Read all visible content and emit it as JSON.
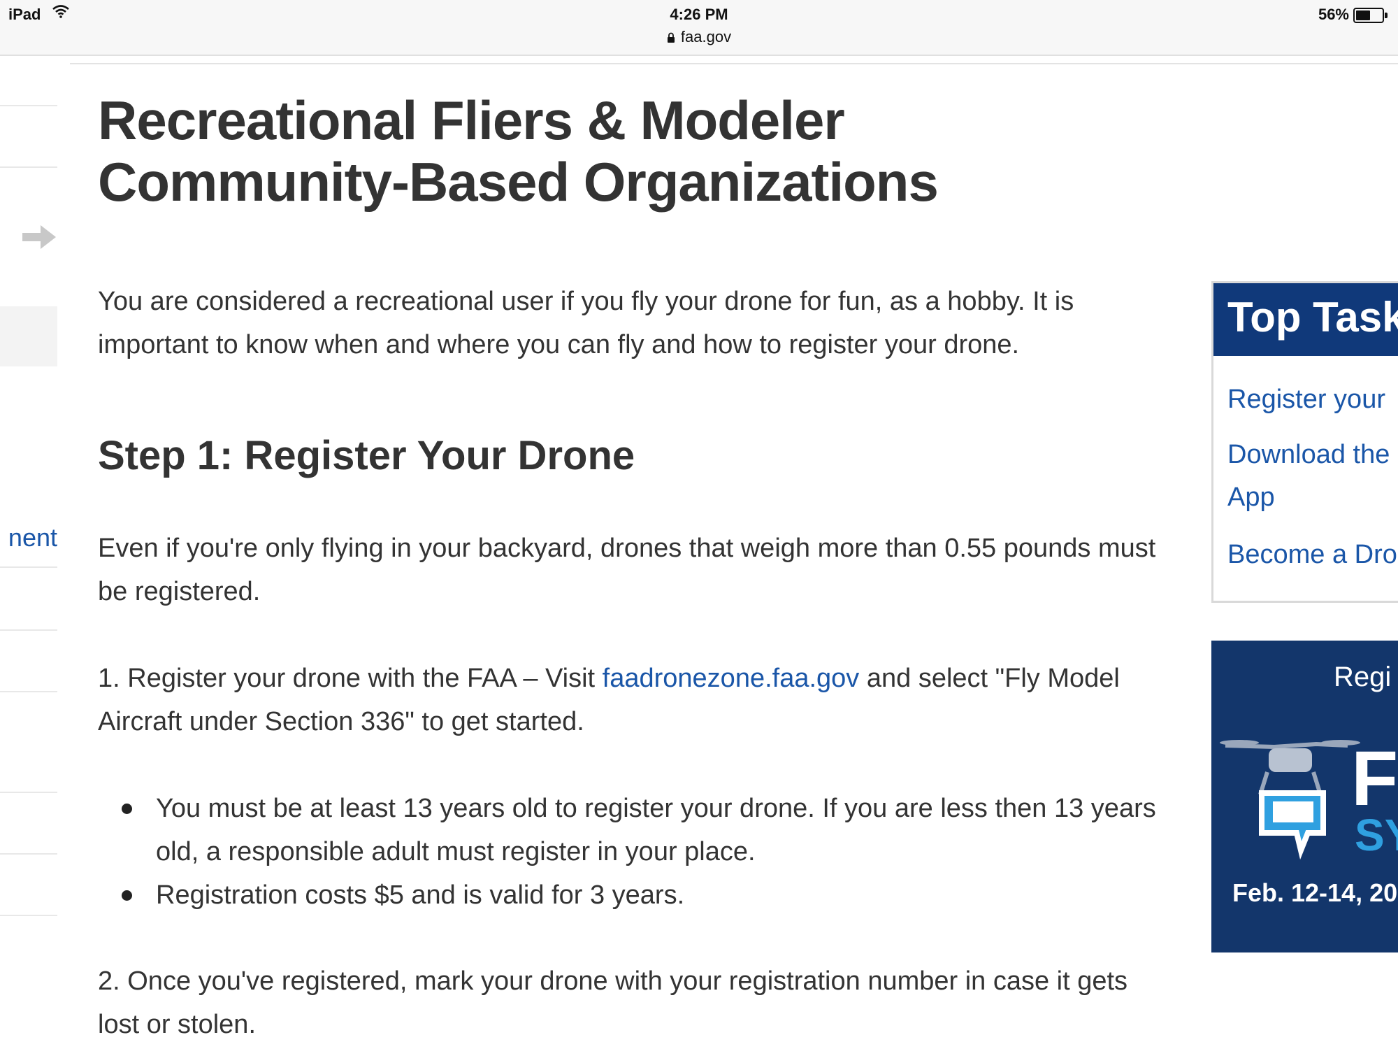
{
  "status_bar": {
    "device": "iPad",
    "time": "4:26 PM",
    "url": "faa.gov",
    "battery": "56%",
    "battery_level": 0.56
  },
  "left_nav": {
    "partial_link": "nent"
  },
  "page": {
    "title_line1": "Recreational Fliers & Modeler",
    "title_line2": "Community-Based Organizations",
    "intro": "You are considered a recreational user if you fly your drone for fun, as a hobby. It is important to know when and where you can fly and how to register your drone.",
    "step1_heading": "Step 1: Register Your Drone",
    "step1_para": "Even if you're only flying in your backyard, drones that weigh more than 0.55 pounds must be registered.",
    "item1_prefix": "1. Register your drone with the FAA – Visit ",
    "item1_link": "faadronezone.faa.gov",
    "item1_suffix": " and select \"Fly Model Aircraft under Section 336\" to get started.",
    "bullets": [
      "You must be at least 13 years old to register your drone. If you are less then 13 years old, a responsible adult must register in your place.",
      "Registration costs $5 and is valid for 3 years."
    ],
    "item2": "2. Once you've registered, mark your drone with your registration number in case it gets lost or stolen."
  },
  "sidebar": {
    "top_tasks_title": "Top Task",
    "links": [
      "Register your",
      "Download the",
      "App",
      "Become a Dro"
    ],
    "promo_top": "Regi",
    "promo_logo_text": "F",
    "promo_logo_sub": "SY",
    "promo_date": "Feb. 12-14, 20"
  },
  "colors": {
    "link": "#1a56a8",
    "header_navy": "#10397a",
    "promo_navy": "#13366b",
    "text": "#333333"
  }
}
